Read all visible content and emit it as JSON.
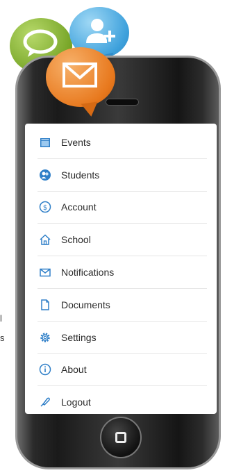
{
  "side_text": [
    "l",
    "s"
  ],
  "menu": [
    {
      "label": "Events",
      "icon": "calendar-icon"
    },
    {
      "label": "Students",
      "icon": "students-icon"
    },
    {
      "label": "Account",
      "icon": "dollar-icon"
    },
    {
      "label": "School",
      "icon": "house-icon"
    },
    {
      "label": "Notifications",
      "icon": "envelope-icon"
    },
    {
      "label": "Documents",
      "icon": "document-icon"
    },
    {
      "label": "Settings",
      "icon": "gear-icon"
    },
    {
      "label": "About",
      "icon": "info-icon"
    },
    {
      "label": "Logout",
      "icon": "logout-icon"
    }
  ],
  "colors": {
    "icon_blue": "#2f7fc8",
    "green_bubble": "#78a628",
    "blue_bubble": "#3ea1dc",
    "orange_bubble": "#e8791e"
  }
}
